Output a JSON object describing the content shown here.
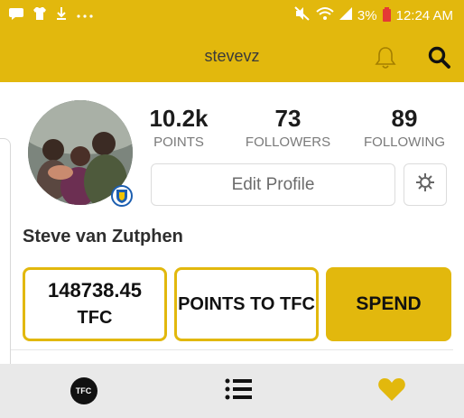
{
  "status_bar": {
    "battery": "3%",
    "time": "12:24 AM",
    "icons": [
      "message-icon",
      "shirt-icon",
      "download-icon",
      "more-icon",
      "mute-icon",
      "wifi-icon",
      "signal-icon",
      "battery-icon"
    ]
  },
  "header": {
    "title": "stevevz",
    "icons": [
      "bell-icon",
      "search-icon"
    ]
  },
  "profile": {
    "name": "Steve van Zutphen",
    "stats": [
      {
        "value": "10.2k",
        "label": "POINTS"
      },
      {
        "value": "73",
        "label": "FOLLOWERS"
      },
      {
        "value": "89",
        "label": "FOLLOWING"
      }
    ],
    "edit_profile_label": "Edit Profile"
  },
  "wallet": {
    "amount": "148738.45",
    "unit": "TFC",
    "points_to_tfc_label": "POINTS TO TFC",
    "spend_label": "SPEND"
  },
  "bottom_nav": {
    "tfc_logo_text": "TFC",
    "items": [
      "tfc-home",
      "list",
      "favorites"
    ]
  },
  "colors": {
    "accent": "#e2b80d",
    "nav_bg": "#e9e9e9",
    "battery_low": "#e53935",
    "badge_blue": "#1d5fb0"
  }
}
